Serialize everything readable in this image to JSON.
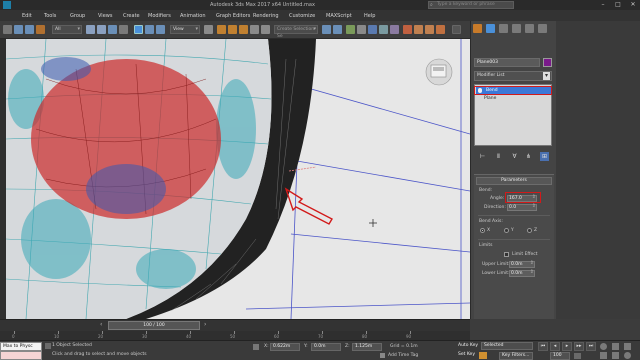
{
  "title": "Autodesk 3ds Max 2017  x64    Untitled.max",
  "search": {
    "placeholder": "Type a keyword or phrase"
  },
  "menu": [
    "Edit",
    "Tools",
    "Group",
    "Views",
    "Create",
    "Modifiers",
    "Animation",
    "Graph Editors",
    "Rendering",
    "Customize",
    "MAXScript",
    "Help"
  ],
  "toolbar": {
    "filter_value": "All",
    "view_value": "View",
    "selection_set_placeholder": "Create Selection Se"
  },
  "panel": {
    "object_name": "Plane003",
    "object_color": "#7a1a8a",
    "modifier_list": "Modifier List",
    "stack": [
      {
        "label": "Bend",
        "selected": true
      },
      {
        "label": "Plane",
        "selected": false
      }
    ],
    "parameters": {
      "title": "Parameters",
      "bend_label": "Bend:",
      "angle_label": "Angle:",
      "angle_value": "167.0",
      "direction_label": "Direction:",
      "direction_value": "0.0",
      "bend_axis_label": "Bend Axis:",
      "axes": [
        "X",
        "Y",
        "Z"
      ],
      "limits_label": "Limits",
      "limit_effect": "Limit Effect",
      "upper_label": "Upper Limit:",
      "upper_value": "0.0m",
      "lower_label": "Lower Limit:",
      "lower_value": "0.0m"
    }
  },
  "timeline": {
    "slider": "100 / 100",
    "ticks": [
      "0",
      "10",
      "20",
      "30",
      "40",
      "50",
      "60",
      "70",
      "80",
      "90"
    ]
  },
  "status": {
    "maxscript": "Max to Physc",
    "line1": "1 Object Selected",
    "line2": "Click and drag to select and move objects",
    "x_label": "X:",
    "x_value": "0.622m",
    "y_label": "Y:",
    "y_value": "0.0m",
    "z_label": "Z:",
    "z_value": "1.125m",
    "grid": "Grid = 0.1m",
    "add_time_tag": "Add Time Tag",
    "auto_key": "Auto Key",
    "selected": "Selected",
    "set_key": "Set Key",
    "key_filters": "Key Filters...",
    "frame": "100"
  }
}
